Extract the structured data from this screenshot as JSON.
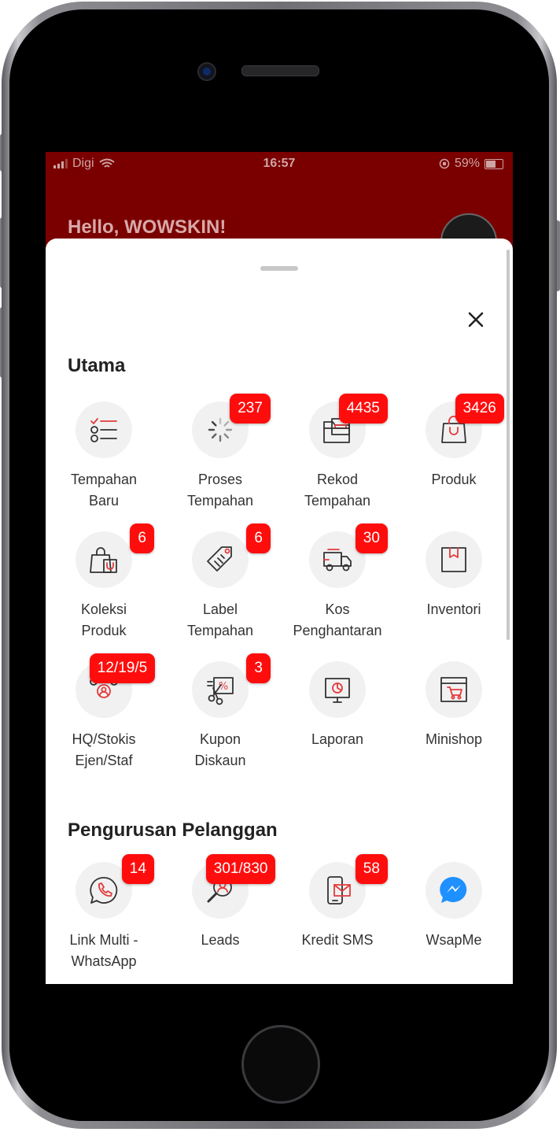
{
  "status_bar": {
    "carrier": "Digi",
    "time": "16:57",
    "battery": "59%"
  },
  "header": {
    "greeting": "Hello, WOWSKIN!"
  },
  "sections": [
    {
      "title": "Utama"
    },
    {
      "title": "Pengurusan Pelanggan"
    }
  ],
  "tiles": [
    {
      "label": "Tempahan\nBaru",
      "badge": "",
      "icon": "checklist-icon"
    },
    {
      "label": "Proses\nTempahan",
      "badge": "237",
      "icon": "loading-spinner-icon"
    },
    {
      "label": "Rekod\nTempahan",
      "badge": "4435",
      "icon": "folder-records-icon"
    },
    {
      "label": "Produk",
      "badge": "3426",
      "icon": "shopping-bag-icon"
    },
    {
      "label": "Koleksi\nProduk",
      "badge": "6",
      "icon": "collection-bag-icon"
    },
    {
      "label": "Label\nTempahan",
      "badge": "6",
      "icon": "price-tag-icon"
    },
    {
      "label": "Kos\nPenghantaran",
      "badge": "30",
      "icon": "delivery-truck-icon"
    },
    {
      "label": "Inventori",
      "badge": "",
      "icon": "inventory-box-icon"
    },
    {
      "label": "HQ/Stokis\nEjen/Staf",
      "badge": "12/19/5",
      "icon": "team-users-icon"
    },
    {
      "label": "Kupon\nDiskaun",
      "badge": "3",
      "icon": "discount-coupon-icon"
    },
    {
      "label": "Laporan",
      "badge": "",
      "icon": "report-board-icon"
    },
    {
      "label": "Minishop",
      "badge": "",
      "icon": "minishop-cart-icon"
    },
    {
      "label": "Link Multi -\nWhatsApp",
      "badge": "14",
      "icon": "whatsapp-icon"
    },
    {
      "label": "Leads",
      "badge": "301/830",
      "icon": "leads-search-icon"
    },
    {
      "label": "Kredit SMS",
      "badge": "58",
      "icon": "sms-phone-icon"
    },
    {
      "label": "WsapMe",
      "badge": "",
      "icon": "messenger-bolt-icon"
    }
  ],
  "colors": {
    "accent": "#ff0d0d",
    "header_bg": "#7a0000",
    "icon_bg": "#f1f1f1",
    "icon_stroke": "#333333"
  }
}
